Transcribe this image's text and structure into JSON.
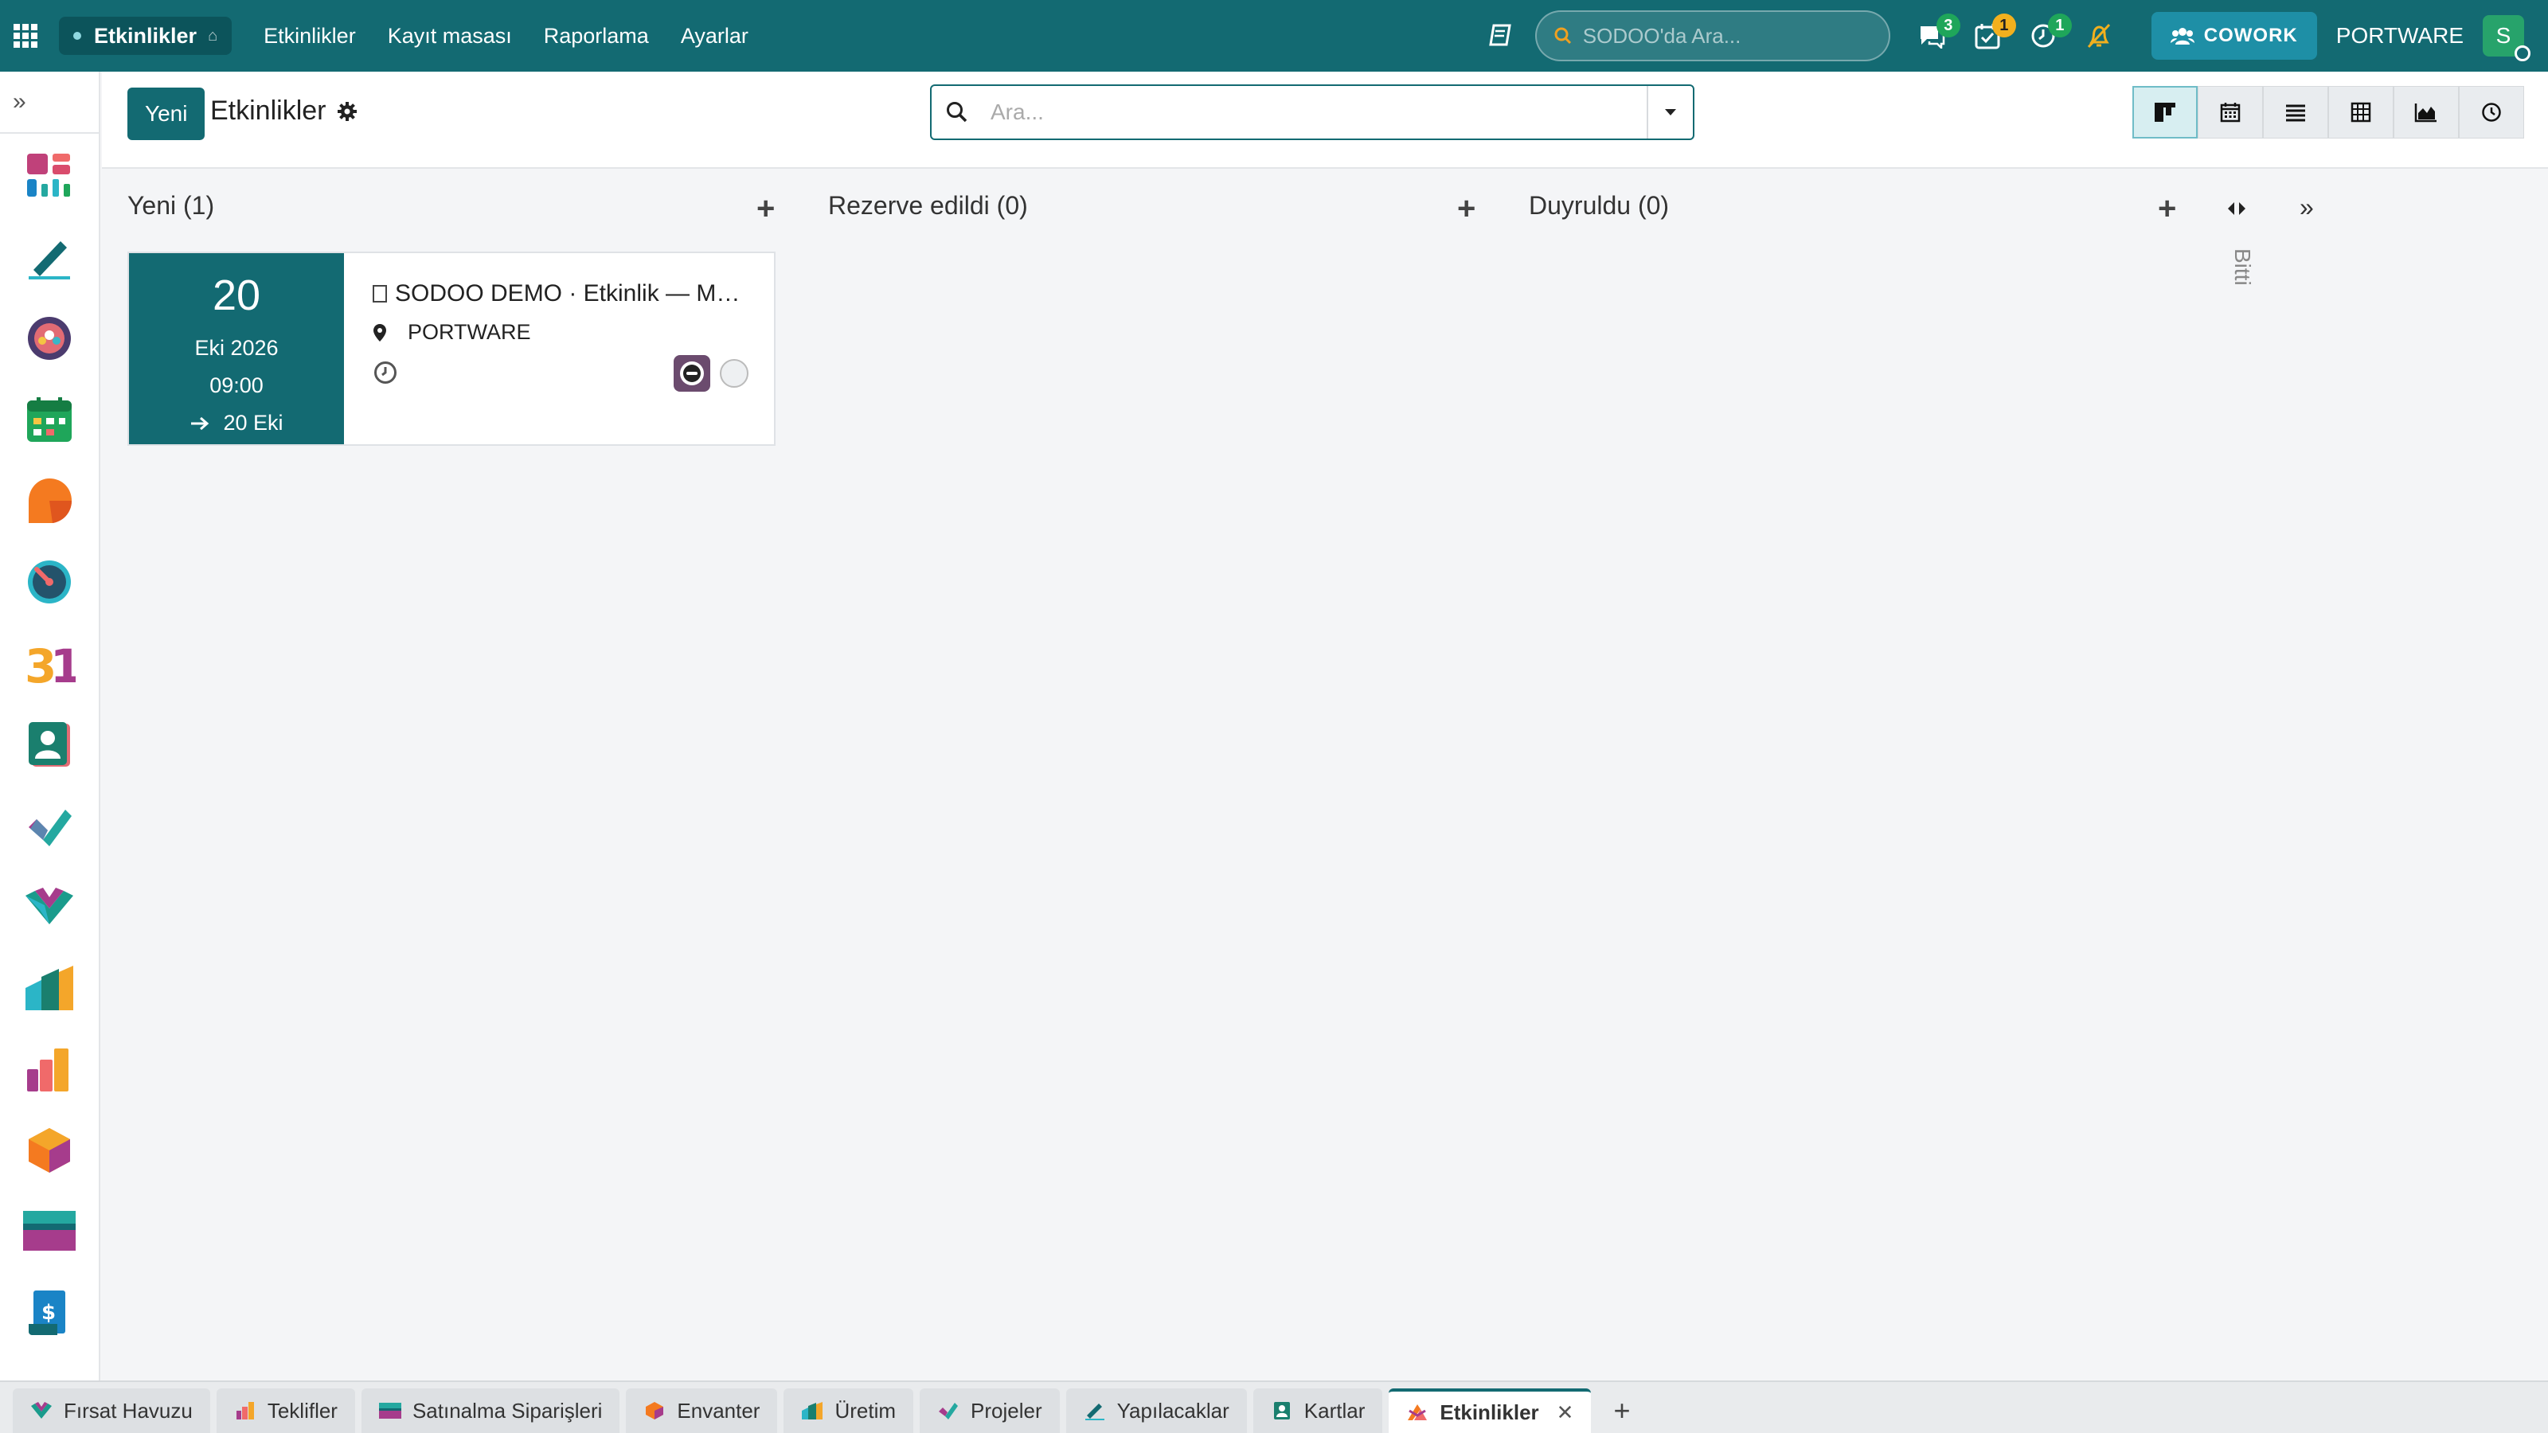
{
  "navbar": {
    "app_name": "Etkinlikler",
    "menu": [
      "Etkinlikler",
      "Kayıt masası",
      "Raporlama",
      "Ayarlar"
    ],
    "global_search_placeholder": "SODOO'da Ara...",
    "messages_badge": "3",
    "activities_badge": "1",
    "timer_badge": "1",
    "cowork_label": "COWORK",
    "company": "PORTWARE",
    "user_initial": "S"
  },
  "control": {
    "new_button": "Yeni",
    "title": "Etkinlikler",
    "search_placeholder": "Ara..."
  },
  "kanban": {
    "columns": [
      {
        "title": "Yeni (1)"
      },
      {
        "title": "Rezerve edildi (0)"
      },
      {
        "title": "Duyruldu (0)"
      }
    ],
    "folded_column": "Bitti",
    "card": {
      "day": "20",
      "month_year": "Eki 2026",
      "time": "09:00",
      "end": "20 Eki",
      "title": "SODOO DEMO · Etkinlik — M…",
      "location": "PORTWARE"
    }
  },
  "tabbar": {
    "tabs": [
      "Fırsat Havuzu",
      "Teklifler",
      "Satınalma Siparişleri",
      "Envanter",
      "Üretim",
      "Projeler",
      "Yapılacaklar",
      "Kartlar",
      "Etkinlikler"
    ]
  },
  "colors": {
    "brand": "#136a72",
    "badge_green": "#1fa65a",
    "badge_yellow": "#f2b01e"
  }
}
